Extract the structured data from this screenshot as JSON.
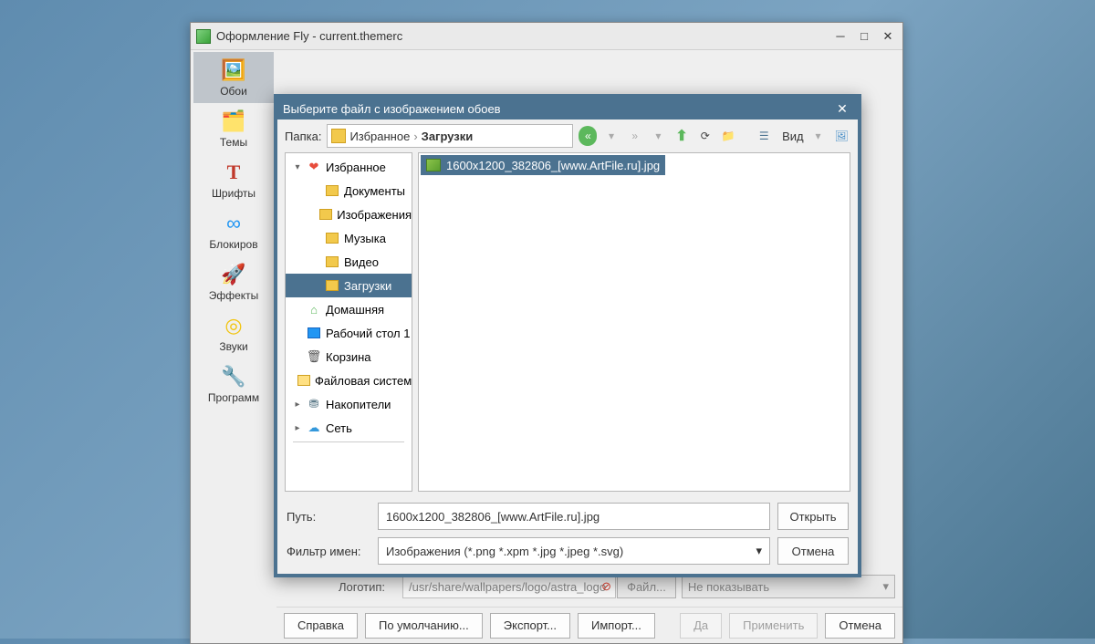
{
  "main_window": {
    "title": "Оформление Fly - current.themerc",
    "sidebar": [
      {
        "label": "Обои",
        "icon": "🖼️",
        "selected": true
      },
      {
        "label": "Темы",
        "icon": "🗂️",
        "selected": false
      },
      {
        "label": "Шрифты",
        "icon": "T",
        "selected": false
      },
      {
        "label": "Блокиров",
        "icon": "∞",
        "selected": false
      },
      {
        "label": "Эффекты",
        "icon": "🚀",
        "selected": false
      },
      {
        "label": "Звуки",
        "icon": "◎",
        "selected": false
      },
      {
        "label": "Программ",
        "icon": "🔧",
        "selected": false
      }
    ],
    "partial_row": {
      "label": "Логотип:",
      "path": "/usr/share/wallpapers/logo/astra_logo",
      "file_btn": "Файл...",
      "display": "Не показывать"
    },
    "buttons": {
      "help": "Справка",
      "defaults": "По умолчанию...",
      "export": "Экспорт...",
      "import": "Импорт...",
      "yes": "Да",
      "apply": "Применить",
      "cancel": "Отмена"
    }
  },
  "dialog": {
    "title": "Выберите файл с изображением обоев",
    "folder_label": "Папка:",
    "breadcrumb": [
      "Избранное",
      "Загрузки"
    ],
    "view_label": "Вид",
    "tree": [
      {
        "label": "Избранное",
        "icon": "heart",
        "depth": 1,
        "expand": "▾"
      },
      {
        "label": "Документы",
        "icon": "folder-y",
        "depth": 2,
        "expand": ""
      },
      {
        "label": "Изображения",
        "icon": "folder-y",
        "depth": 2,
        "expand": ""
      },
      {
        "label": "Музыка",
        "icon": "folder-y",
        "depth": 2,
        "expand": ""
      },
      {
        "label": "Видео",
        "icon": "folder-y",
        "depth": 2,
        "expand": ""
      },
      {
        "label": "Загрузки",
        "icon": "folder-y",
        "depth": 2,
        "expand": "",
        "selected": true
      },
      {
        "label": "Домашняя",
        "icon": "home",
        "depth": 1,
        "expand": ""
      },
      {
        "label": "Рабочий стол 1",
        "icon": "desk",
        "depth": 1,
        "expand": ""
      },
      {
        "label": "Корзина",
        "icon": "trash",
        "depth": 1,
        "expand": ""
      },
      {
        "label": "Файловая система",
        "icon": "fs",
        "depth": 1,
        "expand": ""
      },
      {
        "label": "Накопители",
        "icon": "drives",
        "depth": 1,
        "expand": "▸"
      },
      {
        "label": "Сеть",
        "icon": "net",
        "depth": 1,
        "expand": "▸"
      }
    ],
    "files": [
      {
        "name": "1600x1200_382806_[www.ArtFile.ru].jpg",
        "selected": true
      }
    ],
    "path_label": "Путь:",
    "path_value": "1600x1200_382806_[www.ArtFile.ru].jpg",
    "filter_label": "Фильтр имен:",
    "filter_value": "Изображения (*.png *.xpm *.jpg *.jpeg *.svg)",
    "open": "Открыть",
    "cancel": "Отмена"
  }
}
